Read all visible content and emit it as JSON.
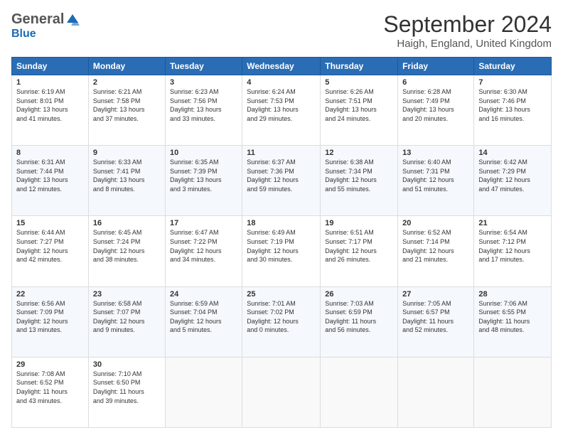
{
  "header": {
    "logo_general": "General",
    "logo_blue": "Blue",
    "month_title": "September 2024",
    "location": "Haigh, England, United Kingdom"
  },
  "days_of_week": [
    "Sunday",
    "Monday",
    "Tuesday",
    "Wednesday",
    "Thursday",
    "Friday",
    "Saturday"
  ],
  "weeks": [
    [
      {
        "day": "1",
        "info": "Sunrise: 6:19 AM\nSunset: 8:01 PM\nDaylight: 13 hours\nand 41 minutes."
      },
      {
        "day": "2",
        "info": "Sunrise: 6:21 AM\nSunset: 7:58 PM\nDaylight: 13 hours\nand 37 minutes."
      },
      {
        "day": "3",
        "info": "Sunrise: 6:23 AM\nSunset: 7:56 PM\nDaylight: 13 hours\nand 33 minutes."
      },
      {
        "day": "4",
        "info": "Sunrise: 6:24 AM\nSunset: 7:53 PM\nDaylight: 13 hours\nand 29 minutes."
      },
      {
        "day": "5",
        "info": "Sunrise: 6:26 AM\nSunset: 7:51 PM\nDaylight: 13 hours\nand 24 minutes."
      },
      {
        "day": "6",
        "info": "Sunrise: 6:28 AM\nSunset: 7:49 PM\nDaylight: 13 hours\nand 20 minutes."
      },
      {
        "day": "7",
        "info": "Sunrise: 6:30 AM\nSunset: 7:46 PM\nDaylight: 13 hours\nand 16 minutes."
      }
    ],
    [
      {
        "day": "8",
        "info": "Sunrise: 6:31 AM\nSunset: 7:44 PM\nDaylight: 13 hours\nand 12 minutes."
      },
      {
        "day": "9",
        "info": "Sunrise: 6:33 AM\nSunset: 7:41 PM\nDaylight: 13 hours\nand 8 minutes."
      },
      {
        "day": "10",
        "info": "Sunrise: 6:35 AM\nSunset: 7:39 PM\nDaylight: 13 hours\nand 3 minutes."
      },
      {
        "day": "11",
        "info": "Sunrise: 6:37 AM\nSunset: 7:36 PM\nDaylight: 12 hours\nand 59 minutes."
      },
      {
        "day": "12",
        "info": "Sunrise: 6:38 AM\nSunset: 7:34 PM\nDaylight: 12 hours\nand 55 minutes."
      },
      {
        "day": "13",
        "info": "Sunrise: 6:40 AM\nSunset: 7:31 PM\nDaylight: 12 hours\nand 51 minutes."
      },
      {
        "day": "14",
        "info": "Sunrise: 6:42 AM\nSunset: 7:29 PM\nDaylight: 12 hours\nand 47 minutes."
      }
    ],
    [
      {
        "day": "15",
        "info": "Sunrise: 6:44 AM\nSunset: 7:27 PM\nDaylight: 12 hours\nand 42 minutes."
      },
      {
        "day": "16",
        "info": "Sunrise: 6:45 AM\nSunset: 7:24 PM\nDaylight: 12 hours\nand 38 minutes."
      },
      {
        "day": "17",
        "info": "Sunrise: 6:47 AM\nSunset: 7:22 PM\nDaylight: 12 hours\nand 34 minutes."
      },
      {
        "day": "18",
        "info": "Sunrise: 6:49 AM\nSunset: 7:19 PM\nDaylight: 12 hours\nand 30 minutes."
      },
      {
        "day": "19",
        "info": "Sunrise: 6:51 AM\nSunset: 7:17 PM\nDaylight: 12 hours\nand 26 minutes."
      },
      {
        "day": "20",
        "info": "Sunrise: 6:52 AM\nSunset: 7:14 PM\nDaylight: 12 hours\nand 21 minutes."
      },
      {
        "day": "21",
        "info": "Sunrise: 6:54 AM\nSunset: 7:12 PM\nDaylight: 12 hours\nand 17 minutes."
      }
    ],
    [
      {
        "day": "22",
        "info": "Sunrise: 6:56 AM\nSunset: 7:09 PM\nDaylight: 12 hours\nand 13 minutes."
      },
      {
        "day": "23",
        "info": "Sunrise: 6:58 AM\nSunset: 7:07 PM\nDaylight: 12 hours\nand 9 minutes."
      },
      {
        "day": "24",
        "info": "Sunrise: 6:59 AM\nSunset: 7:04 PM\nDaylight: 12 hours\nand 5 minutes."
      },
      {
        "day": "25",
        "info": "Sunrise: 7:01 AM\nSunset: 7:02 PM\nDaylight: 12 hours\nand 0 minutes."
      },
      {
        "day": "26",
        "info": "Sunrise: 7:03 AM\nSunset: 6:59 PM\nDaylight: 11 hours\nand 56 minutes."
      },
      {
        "day": "27",
        "info": "Sunrise: 7:05 AM\nSunset: 6:57 PM\nDaylight: 11 hours\nand 52 minutes."
      },
      {
        "day": "28",
        "info": "Sunrise: 7:06 AM\nSunset: 6:55 PM\nDaylight: 11 hours\nand 48 minutes."
      }
    ],
    [
      {
        "day": "29",
        "info": "Sunrise: 7:08 AM\nSunset: 6:52 PM\nDaylight: 11 hours\nand 43 minutes."
      },
      {
        "day": "30",
        "info": "Sunrise: 7:10 AM\nSunset: 6:50 PM\nDaylight: 11 hours\nand 39 minutes."
      },
      {
        "day": "",
        "info": ""
      },
      {
        "day": "",
        "info": ""
      },
      {
        "day": "",
        "info": ""
      },
      {
        "day": "",
        "info": ""
      },
      {
        "day": "",
        "info": ""
      }
    ]
  ]
}
